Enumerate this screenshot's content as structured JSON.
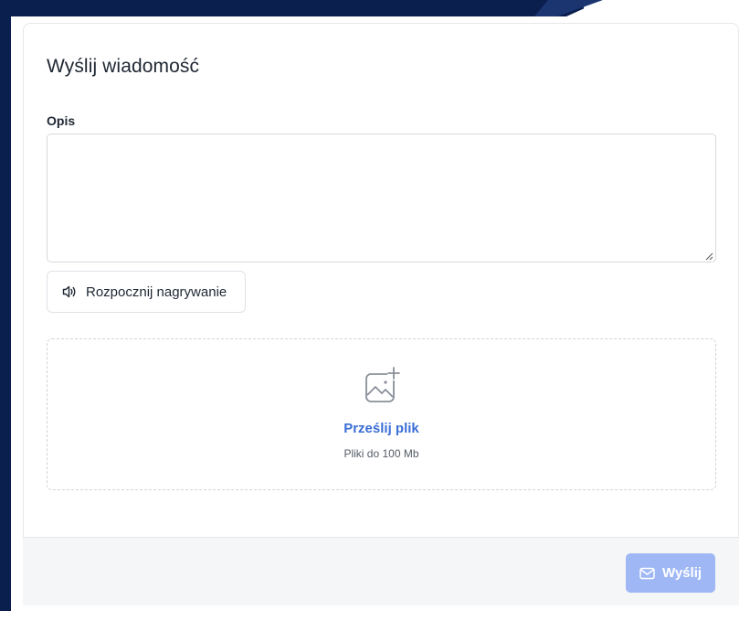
{
  "form": {
    "title": "Wyślij wiadomość",
    "description_label": "Opis",
    "description_value": "",
    "record_button_label": "Rozpocznij nagrywanie",
    "record_icon": "speaker-icon"
  },
  "upload": {
    "link_label": "Prześlij plik",
    "hint": "Pliki do 100 Mb",
    "icon": "image-add-icon"
  },
  "footer": {
    "send_label": "Wyślij",
    "send_icon": "mail-icon"
  },
  "colors": {
    "accent": "#3a6ed6",
    "send_button_disabled": "#9fb7f4",
    "background_navy": "#0b1f4e",
    "footer_bg": "#f5f6f8"
  }
}
